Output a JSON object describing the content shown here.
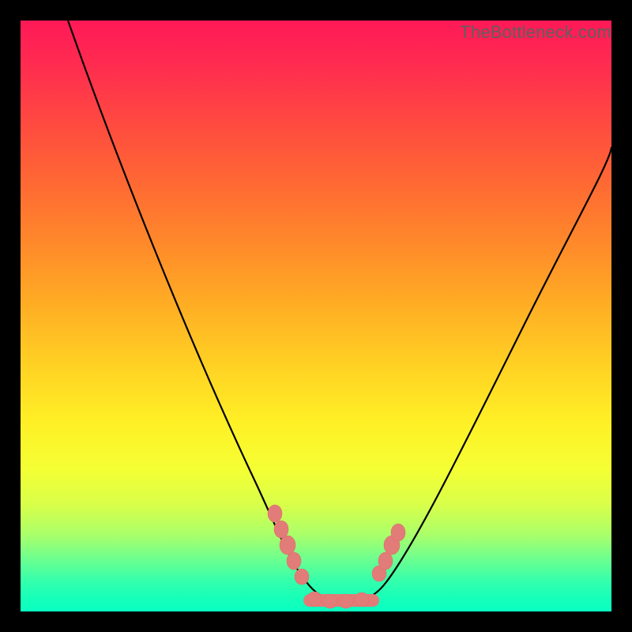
{
  "watermark": "TheBottleneck.com",
  "chart_data": {
    "type": "line",
    "title": "",
    "xlabel": "",
    "ylabel": "",
    "xlim": [
      0,
      100
    ],
    "ylim": [
      0,
      100
    ],
    "grid": false,
    "legend": false,
    "background_gradient": {
      "direction": "vertical",
      "stops": [
        {
          "pos": 0.0,
          "color": "#ff1957"
        },
        {
          "pos": 0.5,
          "color": "#ffd023"
        },
        {
          "pos": 0.8,
          "color": "#e8ff40"
        },
        {
          "pos": 1.0,
          "color": "#09ffc1"
        }
      ]
    },
    "series": [
      {
        "name": "bottleneck-curve",
        "x": [
          8,
          12,
          16,
          20,
          24,
          28,
          32,
          36,
          40,
          44,
          46,
          48,
          50,
          52,
          54,
          56,
          58,
          62,
          66,
          70,
          74,
          78,
          82,
          86,
          90,
          94,
          98,
          100
        ],
        "y": [
          100,
          92,
          84,
          76,
          68,
          60,
          52,
          44,
          36,
          26,
          20,
          12,
          6,
          3,
          2,
          2,
          3,
          6,
          12,
          20,
          28,
          35,
          42,
          48,
          54,
          59,
          64,
          66
        ]
      }
    ],
    "markers": {
      "name": "highlight-dots",
      "color": "#e27c78",
      "points": [
        {
          "x": 45,
          "y": 18
        },
        {
          "x": 46,
          "y": 14
        },
        {
          "x": 47,
          "y": 10
        },
        {
          "x": 48,
          "y": 6
        },
        {
          "x": 50,
          "y": 3
        },
        {
          "x": 52,
          "y": 2
        },
        {
          "x": 54,
          "y": 2
        },
        {
          "x": 56,
          "y": 2
        },
        {
          "x": 58,
          "y": 3
        },
        {
          "x": 60,
          "y": 6
        },
        {
          "x": 61,
          "y": 10
        },
        {
          "x": 62,
          "y": 14
        }
      ]
    }
  }
}
